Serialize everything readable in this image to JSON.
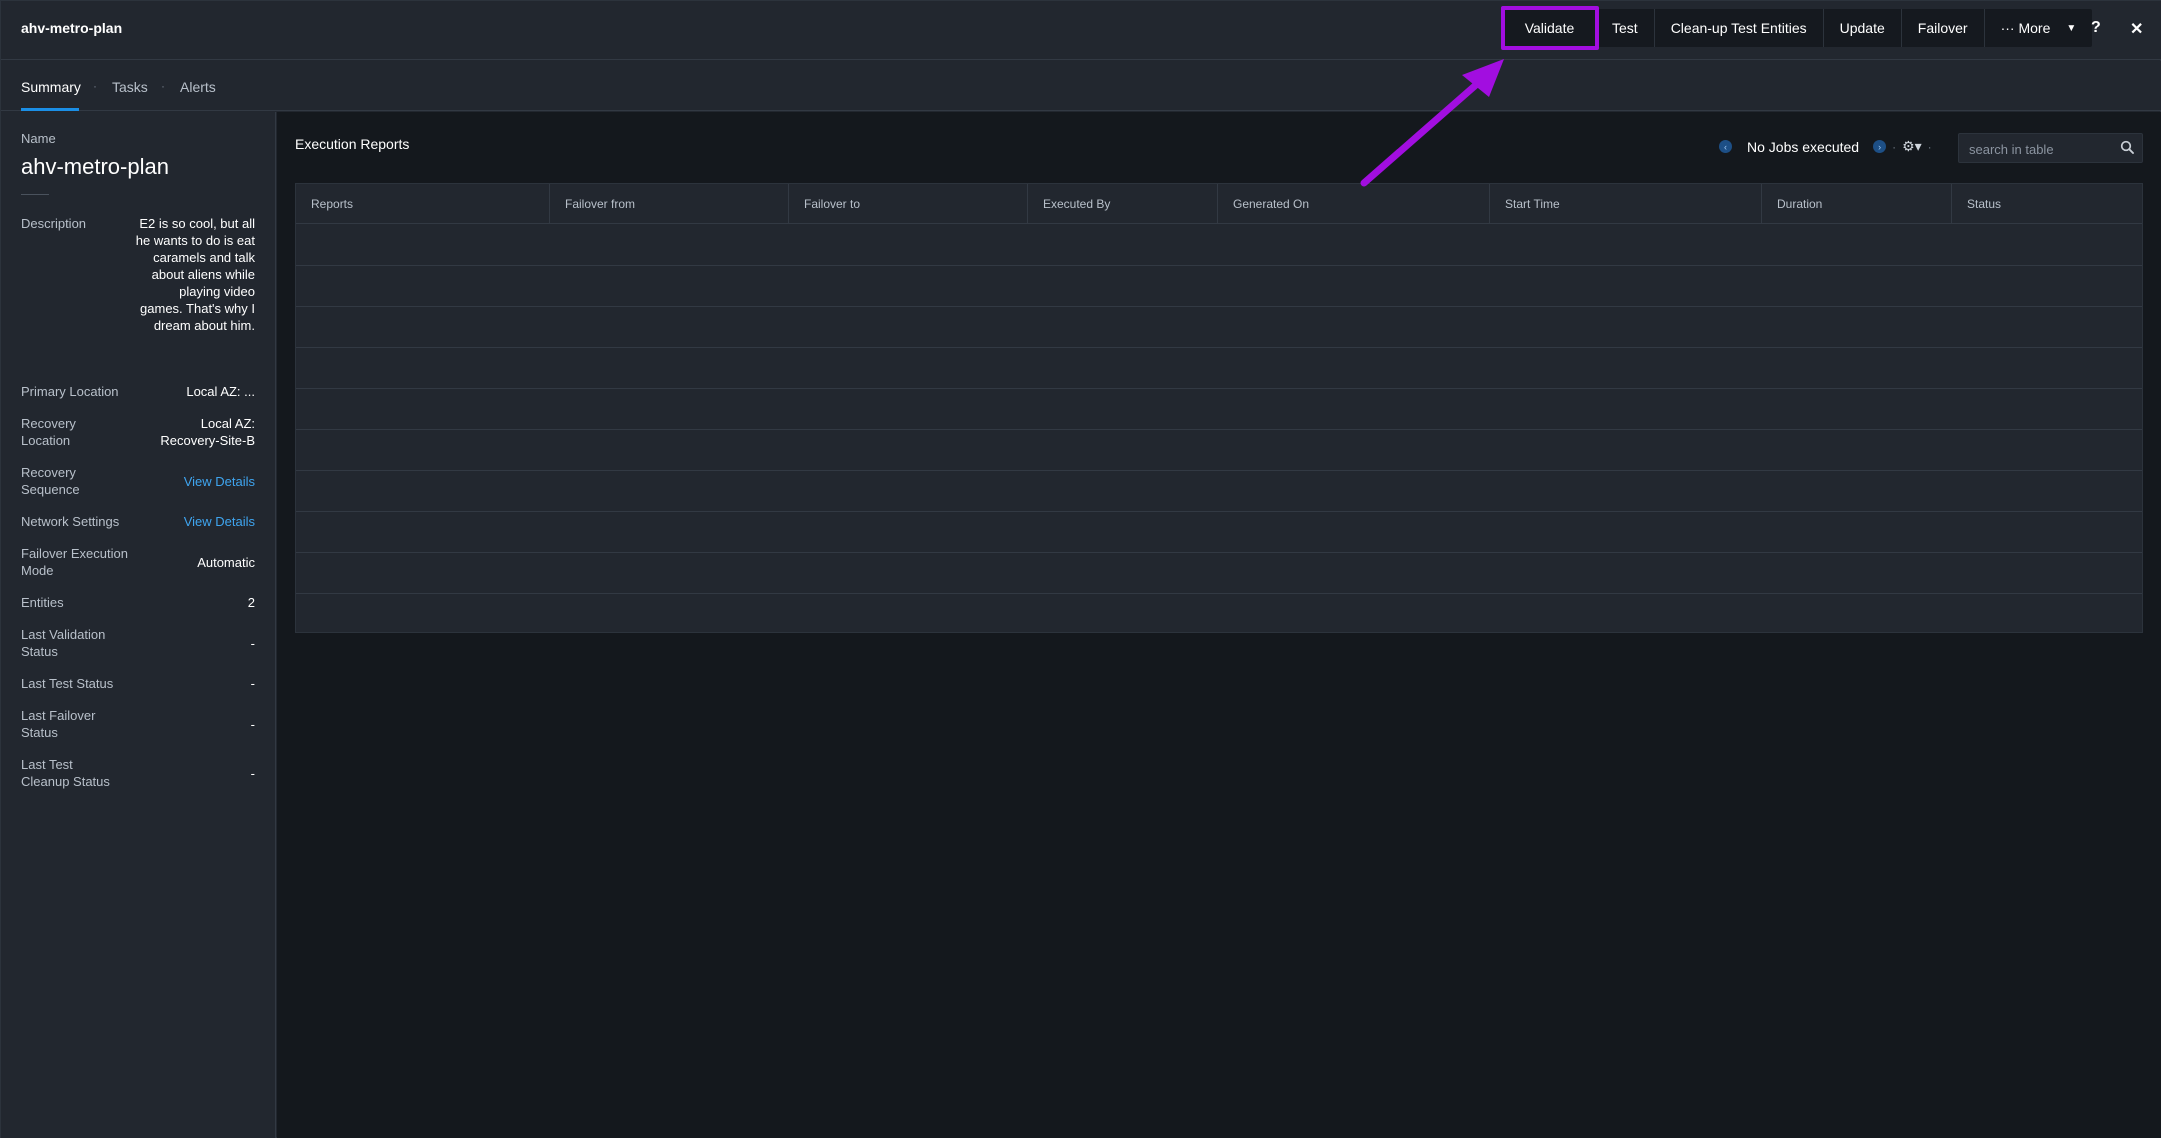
{
  "header": {
    "title": "ahv-metro-plan",
    "actions": {
      "validate": "Validate",
      "test": "Test",
      "cleanup": "Clean-up Test Entities",
      "update": "Update",
      "failover": "Failover",
      "more": "··· More"
    },
    "help_label": "?",
    "close_label": "✕"
  },
  "tabs": {
    "summary": "Summary",
    "tasks": "Tasks",
    "alerts": "Alerts",
    "sep": "·"
  },
  "sidebar": {
    "name_label": "Name",
    "name_value": "ahv-metro-plan",
    "description_label": "Description",
    "description_value": "E2 is so cool, but all he wants to do is eat caramels and talk about aliens while playing video games. That's why I dream about him.",
    "primary_location_label": "Primary Location",
    "primary_location_value": "Local AZ: ...",
    "recovery_location_label": "Recovery Location",
    "recovery_location_value_1": "Local AZ:",
    "recovery_location_value_2": "Recovery-Site-B",
    "recovery_sequence_label": "Recovery Sequence",
    "recovery_sequence_value": "View Details",
    "network_settings_label": "Network Settings",
    "network_settings_value": "View Details",
    "failover_mode_label": "Failover Execution Mode",
    "failover_mode_value": "Automatic",
    "entities_label": "Entities",
    "entities_value": "2",
    "last_validation_label": "Last Validation Status",
    "last_validation_value": "-",
    "last_test_label": "Last Test Status",
    "last_test_value": "-",
    "last_failover_label": "Last Failover Status",
    "last_failover_value": "-",
    "last_cleanup_label": "Last Test Cleanup Status",
    "last_cleanup_value": "-"
  },
  "main": {
    "section_title": "Execution Reports",
    "pager_text": "No Jobs executed",
    "search_placeholder": "search in table",
    "columns": [
      "Reports",
      "Failover from",
      "Failover to",
      "Executed By",
      "Generated On",
      "Start Time",
      "Duration",
      "Status"
    ]
  },
  "colors": {
    "annotation": "#a20ee0",
    "link": "#3fa5f0",
    "accent": "#1b8fe6"
  }
}
